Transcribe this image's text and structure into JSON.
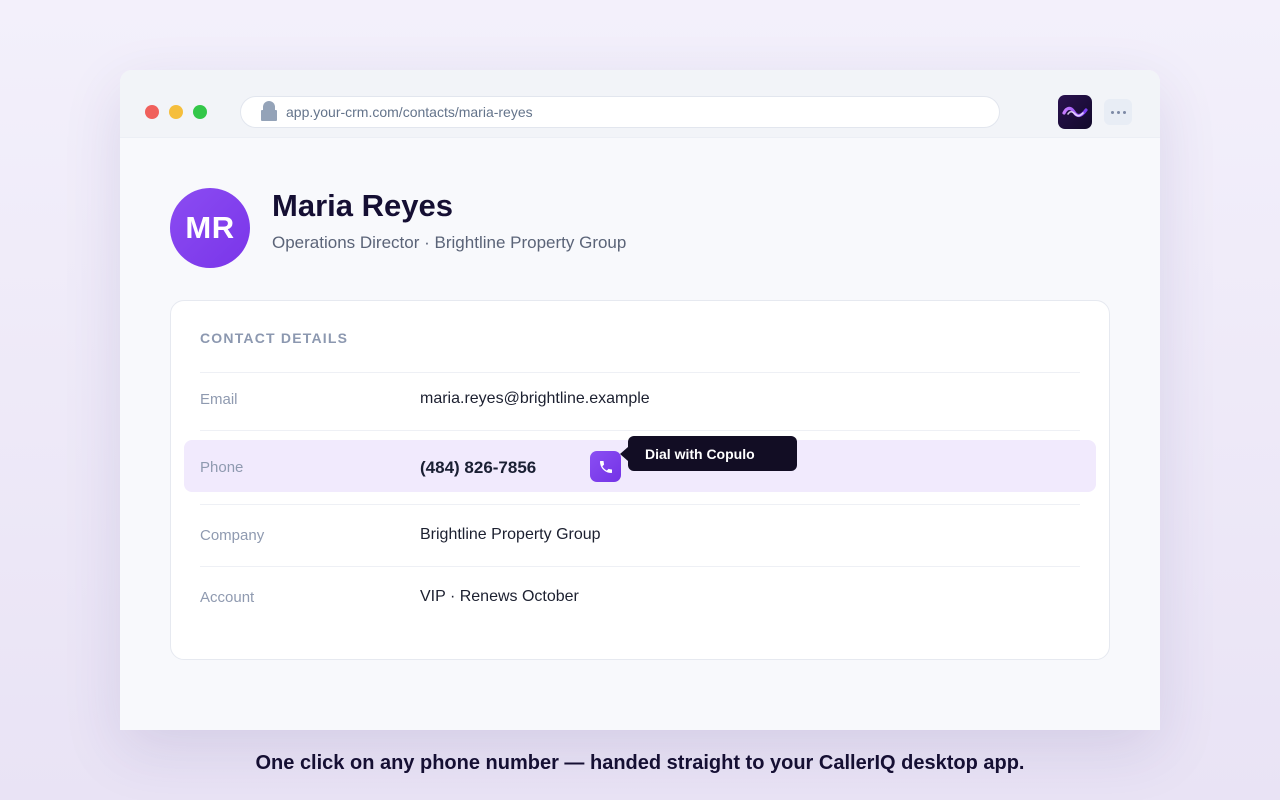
{
  "browser": {
    "url": "app.your-crm.com/contacts/maria-reyes",
    "extension_icon": "callerIQ-wave-logo-icon",
    "menu_icon": "more-horizontal-icon"
  },
  "contact": {
    "initials": "MR",
    "name": "Maria Reyes",
    "role": "Operations Director",
    "separator": "·",
    "company": "Brightline Property Group"
  },
  "details": {
    "title": "CONTACT DETAILS",
    "rows": [
      {
        "label": "Email",
        "value": "maria.reyes@brightline.example"
      },
      {
        "label": "Phone",
        "value": "(484) 826-7856"
      },
      {
        "label": "Company",
        "value": "Brightline Property Group"
      },
      {
        "label": "Account",
        "value": "VIP · Renews October"
      }
    ],
    "dial_icon": "phone-icon",
    "tooltip": "Dial with Copulo"
  },
  "caption": "One click on any phone number — handed straight to your CallerIQ desktop app.",
  "colors": {
    "accent": "#7c3aed",
    "highlight_row": "#f1eafd",
    "tooltip_bg": "#120d24",
    "traffic_red": "#f0605c",
    "traffic_yellow": "#f5be3c",
    "traffic_green": "#33c749"
  }
}
